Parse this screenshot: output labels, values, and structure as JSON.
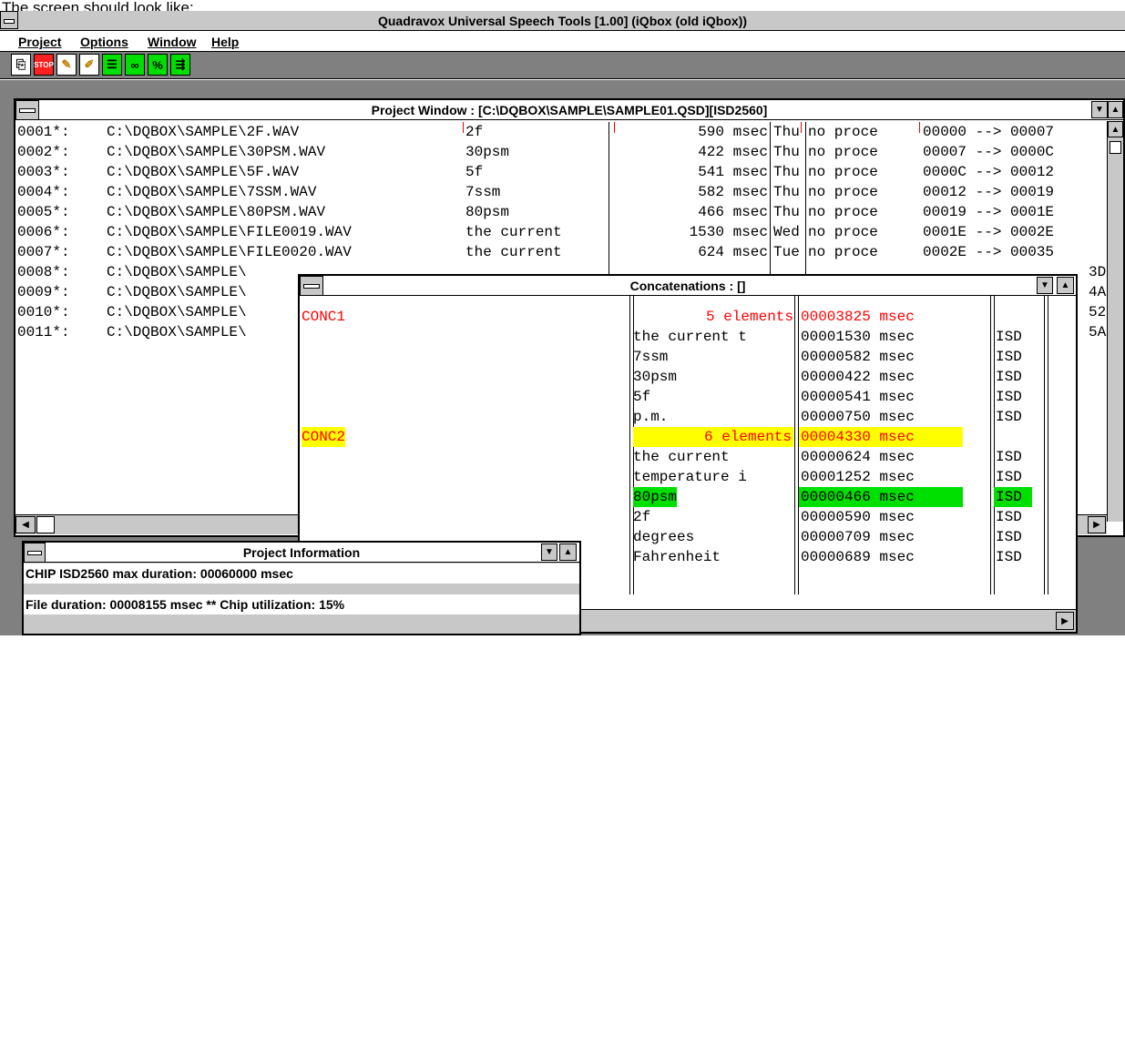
{
  "caption": "The screen should look like:",
  "app": {
    "title": "Quadravox Universal Speech Tools [1.00] (iQbox (old iQbox))"
  },
  "menu": {
    "project": "Project",
    "options": "Options",
    "window": "Window",
    "help": "Help"
  },
  "toolbar": {
    "buttons": [
      {
        "icon": "open-project-icon"
      },
      {
        "icon": "stop-icon",
        "label": "STOP"
      },
      {
        "icon": "flashlight-icon"
      },
      {
        "icon": "flashlight-play-icon"
      },
      {
        "icon": "list-icon"
      },
      {
        "icon": "chain-icon"
      },
      {
        "icon": "chain-edit-icon"
      },
      {
        "icon": "export-icon"
      }
    ]
  },
  "project_window": {
    "title": "Project Window : [C:\\DQBOX\\SAMPLE\\SAMPLE01.QSD][ISD2560]",
    "rows": [
      {
        "id": "0001*:",
        "path": "C:\\DQBOX\\SAMPLE\\2F.WAV",
        "name": "2f",
        "duration": "590 msec",
        "day": "Thu",
        "status": "no proce",
        "range": "00000 --> 00007"
      },
      {
        "id": "0002*:",
        "path": "C:\\DQBOX\\SAMPLE\\30PSM.WAV",
        "name": "30psm",
        "duration": "422 msec",
        "day": "Thu",
        "status": "no proce",
        "range": "00007 --> 0000C"
      },
      {
        "id": "0003*:",
        "path": "C:\\DQBOX\\SAMPLE\\5F.WAV",
        "name": "5f",
        "duration": "541 msec",
        "day": "Thu",
        "status": "no proce",
        "range": "0000C --> 00012"
      },
      {
        "id": "0004*:",
        "path": "C:\\DQBOX\\SAMPLE\\7SSM.WAV",
        "name": "7ssm",
        "duration": "582 msec",
        "day": "Thu",
        "status": "no proce",
        "range": "00012 --> 00019"
      },
      {
        "id": "0005*:",
        "path": "C:\\DQBOX\\SAMPLE\\80PSM.WAV",
        "name": "80psm",
        "duration": "466 msec",
        "day": "Thu",
        "status": "no proce",
        "range": "00019 --> 0001E"
      },
      {
        "id": "0006*:",
        "path": "C:\\DQBOX\\SAMPLE\\FILE0019.WAV",
        "name": "the current",
        "duration": "1530 msec",
        "day": "Wed",
        "status": "no proce",
        "range": "0001E --> 0002E"
      },
      {
        "id": "0007*:",
        "path": "C:\\DQBOX\\SAMPLE\\FILE0020.WAV",
        "name": "the current",
        "duration": "624 msec",
        "day": "Tue",
        "status": "no proce",
        "range": "0002E --> 00035"
      },
      {
        "id": "0008*:",
        "path": "C:\\DQBOX\\SAMPLE\\",
        "name": "",
        "duration": "",
        "day": "",
        "status": "",
        "range": "3D"
      },
      {
        "id": "0009*:",
        "path": "C:\\DQBOX\\SAMPLE\\",
        "name": "",
        "duration": "",
        "day": "",
        "status": "",
        "range": "4A"
      },
      {
        "id": "0010*:",
        "path": "C:\\DQBOX\\SAMPLE\\",
        "name": "",
        "duration": "",
        "day": "",
        "status": "",
        "range": "52"
      },
      {
        "id": "0011*:",
        "path": "C:\\DQBOX\\SAMPLE\\",
        "name": "",
        "duration": "",
        "day": "",
        "status": "",
        "range": "5A"
      }
    ]
  },
  "concatenations": {
    "title": "Concatenations : []",
    "groups": [
      {
        "name": "CONC1",
        "summary": "5 elements",
        "total": "00003825 msec",
        "items": [
          {
            "name": "the current t",
            "duration": "00001530 msec",
            "chip": "ISD"
          },
          {
            "name": "7ssm",
            "duration": "00000582 msec",
            "chip": "ISD"
          },
          {
            "name": "30psm",
            "duration": "00000422 msec",
            "chip": "ISD"
          },
          {
            "name": "5f",
            "duration": "00000541 msec",
            "chip": "ISD"
          },
          {
            "name": "p.m.",
            "duration": "00000750 msec",
            "chip": "ISD"
          }
        ]
      },
      {
        "name": "CONC2",
        "summary": "6 elements",
        "total": "00004330 msec",
        "items": [
          {
            "name": "the current",
            "duration": "00000624 msec",
            "chip": "ISD"
          },
          {
            "name": "temperature i",
            "duration": "00001252 msec",
            "chip": "ISD"
          },
          {
            "name": "80psm",
            "duration": "00000466 msec",
            "chip": "ISD"
          },
          {
            "name": "2f",
            "duration": "00000590 msec",
            "chip": "ISD"
          },
          {
            "name": "degrees",
            "duration": "00000709 msec",
            "chip": "ISD"
          },
          {
            "name": "Fahrenheit",
            "duration": "00000689 msec",
            "chip": "ISD"
          }
        ]
      }
    ]
  },
  "project_info": {
    "title": "Project Information",
    "line1": "CHIP ISD2560 max duration: 00060000 msec",
    "line2": "File duration: 00008155 msec ** Chip utilization: 15%"
  },
  "colors": {
    "highlight_yellow": "#ffff00",
    "highlight_green": "#00e000",
    "red_text": "#ff0000"
  }
}
